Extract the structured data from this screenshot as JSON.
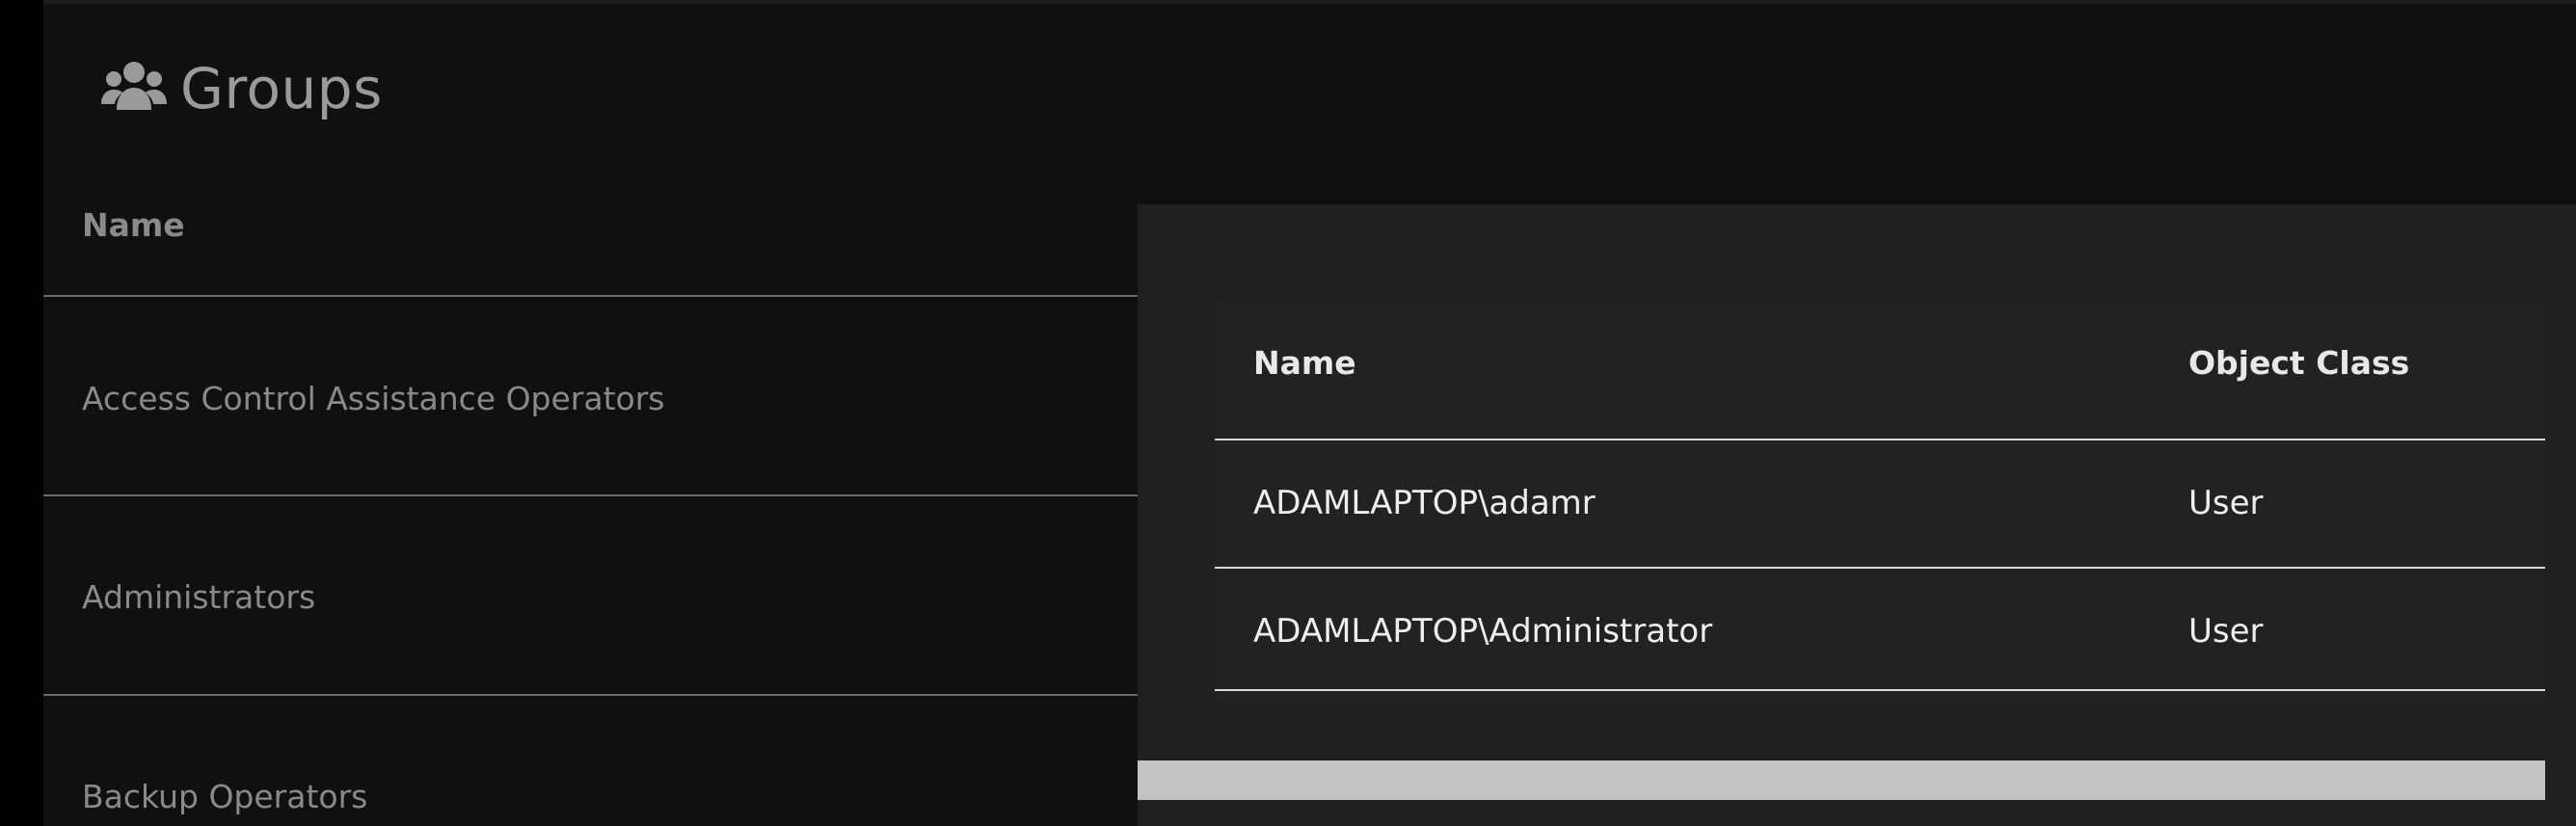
{
  "header": {
    "title": "Groups",
    "icon": "users-icon"
  },
  "groups_table": {
    "column_header": "Name",
    "rows": [
      "Access Control Assistance Operators",
      "Administrators",
      "Backup Operators"
    ]
  },
  "members_dialog": {
    "columns": [
      "Name",
      "Object Class"
    ],
    "rows": [
      {
        "name": "ADAMLAPTOP\\adamr",
        "object_class": "User"
      },
      {
        "name": "ADAMLAPTOP\\Administrator",
        "object_class": "User"
      }
    ]
  },
  "colors": {
    "page_background": "#101010",
    "dialog_background": "#202020",
    "muted_text": "#8a8a8a",
    "bright_text": "#eeeeee",
    "scrollbar": "#c3c3c3"
  }
}
